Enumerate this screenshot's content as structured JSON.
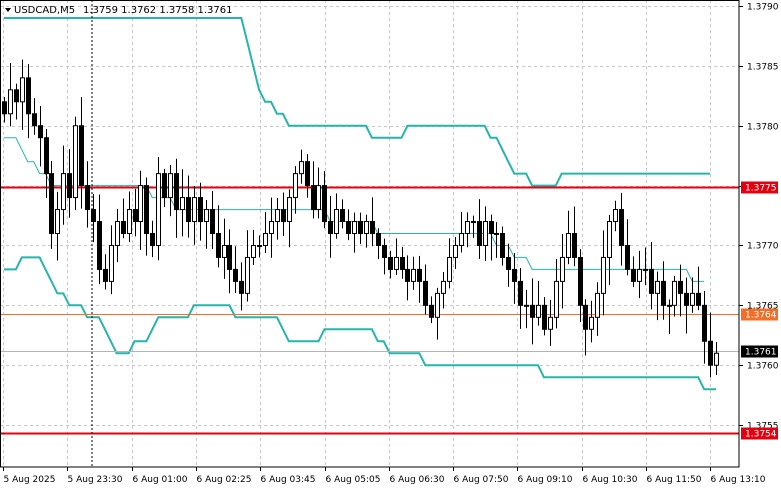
{
  "header": {
    "symbol": "USDCAD,M5",
    "ohlc": "1.3759 1.3762 1.3758 1.3761"
  },
  "colors": {
    "bb_outer": "#26b5ad",
    "bb_mid": "#26b5ad",
    "resistance": "#e3000f",
    "pivot": "#f0702a",
    "candle": "#000000",
    "grid": "#c8c8c8",
    "axis": "#000000"
  },
  "chart_data": {
    "type": "candlestick",
    "symbol": "USDCAD",
    "timeframe": "M5",
    "ylim": [
      1.37515,
      1.37905
    ],
    "y_ticks": [
      "1.3790",
      "1.3785",
      "1.3780",
      "1.3775",
      "1.3770",
      "1.3765",
      "1.3760",
      "1.3755"
    ],
    "x_ticks": [
      "5 Aug 2025",
      "5 Aug 23:30",
      "6 Aug 01:00",
      "6 Aug 02:25",
      "6 Aug 03:45",
      "6 Aug 05:05",
      "6 Aug 06:30",
      "6 Aug 07:50",
      "6 Aug 09:10",
      "6 Aug 10:30",
      "6 Aug 11:50",
      "6 Aug 13:10"
    ],
    "horizontal_levels": [
      {
        "label": "1.3775",
        "value": 1.37749,
        "role": "resistance"
      },
      {
        "label": "1.3764",
        "value": 1.37643,
        "role": "pivot"
      },
      {
        "label": "1.3754",
        "value": 1.37543,
        "role": "resistance"
      }
    ],
    "current_price": {
      "label": "1.3761",
      "value": 1.37612
    },
    "grid": true,
    "closes": [
      1.3781,
      1.3783,
      1.3782,
      1.3784,
      1.3781,
      1.378,
      1.3779,
      1.3776,
      1.3771,
      1.3773,
      1.3776,
      1.3774,
      1.378,
      1.3775,
      1.3773,
      1.3772,
      1.3768,
      1.3767,
      1.377,
      1.3772,
      1.3771,
      1.3773,
      1.3772,
      1.3775,
      1.3771,
      1.377,
      1.3776,
      1.3774,
      1.3776,
      1.3773,
      1.3774,
      1.3772,
      1.3774,
      1.3772,
      1.3773,
      1.3771,
      1.3769,
      1.377,
      1.3768,
      1.3767,
      1.3766,
      1.3769,
      1.377,
      1.377,
      1.3771,
      1.3772,
      1.3773,
      1.3772,
      1.3774,
      1.3776,
      1.3777,
      1.3775,
      1.3773,
      1.3775,
      1.3772,
      1.3771,
      1.3773,
      1.3772,
      1.3771,
      1.3772,
      1.3771,
      1.3772,
      1.3771,
      1.377,
      1.3769,
      1.3768,
      1.3769,
      1.3768,
      1.3767,
      1.3768,
      1.3767,
      1.3765,
      1.3764,
      1.3766,
      1.3767,
      1.3769,
      1.377,
      1.3771,
      1.3772,
      1.3772,
      1.377,
      1.3772,
      1.3771,
      1.3771,
      1.3769,
      1.3768,
      1.3767,
      1.3765,
      1.3765,
      1.3764,
      1.3765,
      1.3763,
      1.3764,
      1.3767,
      1.3769,
      1.3771,
      1.3769,
      1.3765,
      1.3763,
      1.3764,
      1.3766,
      1.3769,
      1.3772,
      1.3773,
      1.377,
      1.3768,
      1.3767,
      1.3768,
      1.3768,
      1.3766,
      1.3767,
      1.3765,
      1.3765,
      1.3767,
      1.3766,
      1.3765,
      1.3766,
      1.3765,
      1.3762,
      1.376,
      1.3761
    ],
    "bb_upper": [
      1.3789,
      1.3789,
      1.3789,
      1.3789,
      1.3789,
      1.3789,
      1.3789,
      1.3789,
      1.3789,
      1.3789,
      1.3789,
      1.3789,
      1.3789,
      1.3789,
      1.3789,
      1.3789,
      1.3789,
      1.3789,
      1.3789,
      1.3789,
      1.3789,
      1.3789,
      1.3789,
      1.3789,
      1.3789,
      1.3789,
      1.3789,
      1.3789,
      1.3789,
      1.3789,
      1.3789,
      1.3789,
      1.3789,
      1.3789,
      1.3789,
      1.3789,
      1.3789,
      1.3789,
      1.3789,
      1.3789,
      1.3789,
      1.3787,
      1.3785,
      1.3783,
      1.3782,
      1.3782,
      1.3781,
      1.3781,
      1.378,
      1.378,
      1.378,
      1.378,
      1.378,
      1.378,
      1.378,
      1.378,
      1.378,
      1.378,
      1.378,
      1.378,
      1.378,
      1.378,
      1.3779,
      1.3779,
      1.3779,
      1.3779,
      1.3779,
      1.3779,
      1.378,
      1.378,
      1.378,
      1.378,
      1.378,
      1.378,
      1.378,
      1.378,
      1.378,
      1.378,
      1.378,
      1.378,
      1.378,
      1.378,
      1.3779,
      1.3779,
      1.3778,
      1.3777,
      1.3776,
      1.3776,
      1.3776,
      1.3775,
      1.3775,
      1.3775,
      1.3775,
      1.3775,
      1.3776,
      1.3776,
      1.3776,
      1.3776,
      1.3776,
      1.3776,
      1.3776,
      1.3776,
      1.3776,
      1.3776,
      1.3776,
      1.3776,
      1.3776,
      1.3776,
      1.3776,
      1.3776,
      1.3776,
      1.3776,
      1.3776,
      1.3776,
      1.3776,
      1.3776,
      1.3776,
      1.3776,
      1.3776,
      1.3776
    ],
    "bb_middle": [
      1.3779,
      1.3779,
      1.3779,
      1.3778,
      1.3777,
      1.3777,
      1.3776,
      1.3776,
      1.3775,
      1.3775,
      1.3775,
      1.3775,
      1.3775,
      1.3775,
      1.3775,
      1.3775,
      1.3775,
      1.3775,
      1.3775,
      1.3775,
      1.3775,
      1.3775,
      1.3775,
      1.3775,
      1.3775,
      1.3774,
      1.3774,
      1.3774,
      1.3774,
      1.3773,
      1.3773,
      1.3773,
      1.3773,
      1.3773,
      1.3773,
      1.3773,
      1.3773,
      1.3773,
      1.3773,
      1.3773,
      1.3773,
      1.3773,
      1.3773,
      1.3773,
      1.3773,
      1.3773,
      1.3773,
      1.3773,
      1.3773,
      1.3773,
      1.3773,
      1.3773,
      1.3773,
      1.3773,
      1.3773,
      1.3772,
      1.3772,
      1.3772,
      1.3772,
      1.3772,
      1.3772,
      1.3772,
      1.3772,
      1.3771,
      1.3771,
      1.3771,
      1.3771,
      1.3771,
      1.3771,
      1.3771,
      1.3771,
      1.3771,
      1.3771,
      1.3771,
      1.3771,
      1.3771,
      1.3771,
      1.3771,
      1.3771,
      1.3771,
      1.3771,
      1.3771,
      1.3771,
      1.377,
      1.377,
      1.377,
      1.3769,
      1.3769,
      1.3769,
      1.3768,
      1.3768,
      1.3768,
      1.3768,
      1.3768,
      1.3768,
      1.3768,
      1.3768,
      1.3768,
      1.3768,
      1.3768,
      1.3768,
      1.3768,
      1.3768,
      1.3768,
      1.3768,
      1.3768,
      1.3768,
      1.3768,
      1.3768,
      1.3768,
      1.3768,
      1.3768,
      1.3768,
      1.3768,
      1.3768,
      1.3768,
      1.3767,
      1.3767,
      1.3767
    ],
    "bb_lower": [
      1.3768,
      1.3768,
      1.3768,
      1.3769,
      1.3769,
      1.3769,
      1.3769,
      1.3768,
      1.3767,
      1.3766,
      1.3766,
      1.3765,
      1.3765,
      1.3765,
      1.3764,
      1.3764,
      1.3764,
      1.3763,
      1.3762,
      1.3761,
      1.3761,
      1.3761,
      1.3762,
      1.3762,
      1.3762,
      1.3763,
      1.3764,
      1.3764,
      1.3764,
      1.3764,
      1.3764,
      1.3764,
      1.3765,
      1.3765,
      1.3765,
      1.3765,
      1.3765,
      1.3765,
      1.3765,
      1.3764,
      1.3764,
      1.3764,
      1.3764,
      1.3764,
      1.3764,
      1.3764,
      1.3764,
      1.3763,
      1.3762,
      1.3762,
      1.3762,
      1.3762,
      1.3762,
      1.3762,
      1.3763,
      1.3763,
      1.3763,
      1.3763,
      1.3763,
      1.3763,
      1.3763,
      1.3763,
      1.3763,
      1.3762,
      1.3762,
      1.3761,
      1.3761,
      1.3761,
      1.3761,
      1.3761,
      1.3761,
      1.376,
      1.376,
      1.376,
      1.376,
      1.376,
      1.376,
      1.376,
      1.376,
      1.376,
      1.376,
      1.376,
      1.376,
      1.376,
      1.376,
      1.376,
      1.376,
      1.376,
      1.376,
      1.376,
      1.376,
      1.3759,
      1.3759,
      1.3759,
      1.3759,
      1.3759,
      1.3759,
      1.3759,
      1.3759,
      1.3759,
      1.3759,
      1.3759,
      1.3759,
      1.3759,
      1.3759,
      1.3759,
      1.3759,
      1.3759,
      1.3759,
      1.3759,
      1.3759,
      1.3759,
      1.3759,
      1.3759,
      1.3759,
      1.3759,
      1.3759,
      1.3759,
      1.3758,
      1.3758,
      1.3758
    ]
  }
}
